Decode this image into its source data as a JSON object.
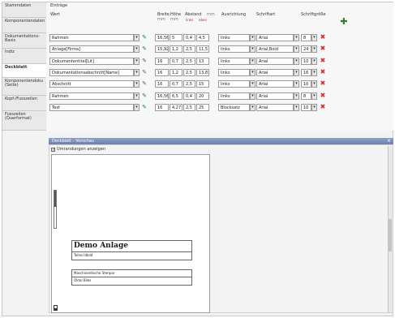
{
  "sidebar": {
    "items": [
      {
        "label": "Stammdaten",
        "active": false
      },
      {
        "label": "Komponentendaten",
        "active": false
      },
      {
        "label": "Dokumentations-Basis",
        "active": false
      },
      {
        "label": "Indiz",
        "active": false
      },
      {
        "label": "Deckblatt",
        "active": true
      },
      {
        "label": "Komponentendoku (Seite)",
        "active": false
      },
      {
        "label": "Kopf-/Fusszeilen",
        "active": false
      },
      {
        "label": "Fusszeilen (Querformat)",
        "active": false
      }
    ]
  },
  "table": {
    "group_label": "Einträge",
    "headers": {
      "wert": "Wert",
      "breite": "Breite",
      "breite_unit": "mm",
      "hoehe": "Höhe",
      "hoehe_unit": "mm",
      "abstand": "Abstand",
      "abstand_unit": "mm",
      "abstand_sub1": "links",
      "abstand_sub2": "oben",
      "ausrichtung": "Ausrichtung",
      "schriftart": "Schriftart",
      "schriftgroesse": "Schriftgröße"
    },
    "rows": [
      {
        "wert": "Rahmen",
        "breite": "16,56",
        "hoehe": "5",
        "links": "0,4",
        "oben": "4,5",
        "ausrichtung": "links",
        "font": "Arial",
        "size": "8"
      },
      {
        "wert": "Anlage[Firma]",
        "breite": "15,92",
        "hoehe": "1,2",
        "links": "2,5",
        "oben": "11,5",
        "ausrichtung": "links",
        "font": "Arial,Bold",
        "size": "24"
      },
      {
        "wert": "Dokumententitel[Lit]",
        "breite": "16",
        "hoehe": "0,7",
        "links": "2,5",
        "oben": "13",
        "ausrichtung": "links",
        "font": "Arial",
        "size": "10"
      },
      {
        "wert": "Dokumentationsabschnitt[Name]",
        "breite": "16",
        "hoehe": "1,2",
        "links": "2,5",
        "oben": "13,8",
        "ausrichtung": "links",
        "font": "Arial",
        "size": "16"
      },
      {
        "wert": "Abschnitt",
        "breite": "16",
        "hoehe": "0,7",
        "links": "2,5",
        "oben": "15",
        "ausrichtung": "links",
        "font": "Arial",
        "size": "10"
      },
      {
        "wert": "Rahmen",
        "breite": "16,56",
        "hoehe": "6,5",
        "links": "0,4",
        "oben": "20",
        "ausrichtung": "links",
        "font": "Arial",
        "size": "8"
      },
      {
        "wert": "Text",
        "breite": "16",
        "hoehe": "4,27",
        "links": "2,5",
        "oben": "25",
        "ausrichtung": "Blocksatz",
        "font": "Arial",
        "size": "10"
      }
    ]
  },
  "preview": {
    "title": "Deckblatt - Vorschau",
    "checkbox_label": "Umrandungen anzeigen",
    "checkbox_checked": true,
    "doc_title": "Demo Anlage",
    "doc_subtitle": "Teiles Idbild",
    "box2_line1": "Maschinentische Steripar",
    "box2_line2": "Oktal Biles"
  },
  "colors": {
    "accent": "#2e7d32",
    "delete": "#d32f2f",
    "title_bar": "#7a8fbb"
  }
}
